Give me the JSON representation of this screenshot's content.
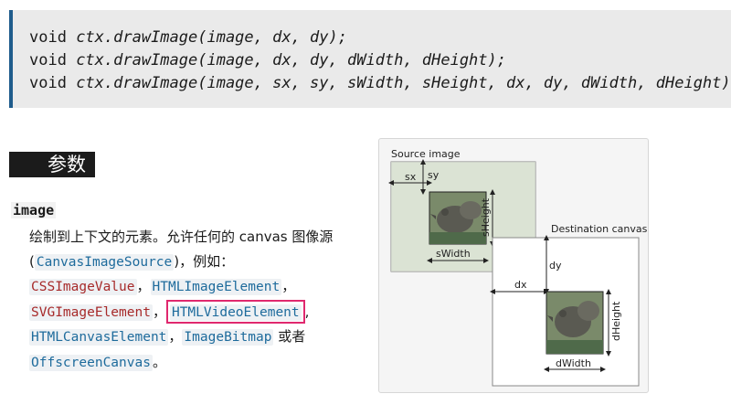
{
  "code": {
    "lines": [
      {
        "prefix": "void ",
        "call": "ctx.drawImage(image, dx, dy);"
      },
      {
        "prefix": "void ",
        "call": "ctx.drawImage(image, dx, dy, dWidth, dHeight);"
      },
      {
        "prefix": "void ",
        "call": "ctx.drawImage(image, sx, sy, sWidth, sHeight, dx, dy, dWidth, dHeight);"
      }
    ]
  },
  "section": {
    "heading": "参数",
    "param_name": "image",
    "desc_line1": "绘制到上下文的元素。允许任何的 canvas 图像源",
    "desc_open": "(",
    "canvas_image_source": "CanvasImageSource",
    "desc_close": ")，例如：",
    "tokens": {
      "css_image_value": "CSSImageValue",
      "html_image_element": "HTMLImageElement",
      "svg_image_element": "SVGImageElement",
      "html_video_element": "HTMLVideoElement",
      "html_canvas_element": "HTMLCanvasElement",
      "image_bitmap": "ImageBitmap",
      "offscreen_canvas": "OffscreenCanvas"
    },
    "sep_comma": "，",
    "sep_comma_ascii": ",",
    "or_text": "或者",
    "period": "。",
    "colors": {
      "red_token": "#a72a2a",
      "blue_token": "#1e6b9c",
      "highlight_border": "#e0286e",
      "code_border": "#1f5c8c"
    }
  },
  "diagram": {
    "source_label": "Source image",
    "dest_label": "Destination canvas",
    "sx": "sx",
    "sy": "sy",
    "sHeight": "sHeight",
    "sWidth": "sWidth",
    "dx": "dx",
    "dy": "dy",
    "dHeight": "dHeight",
    "dWidth": "dWidth"
  }
}
